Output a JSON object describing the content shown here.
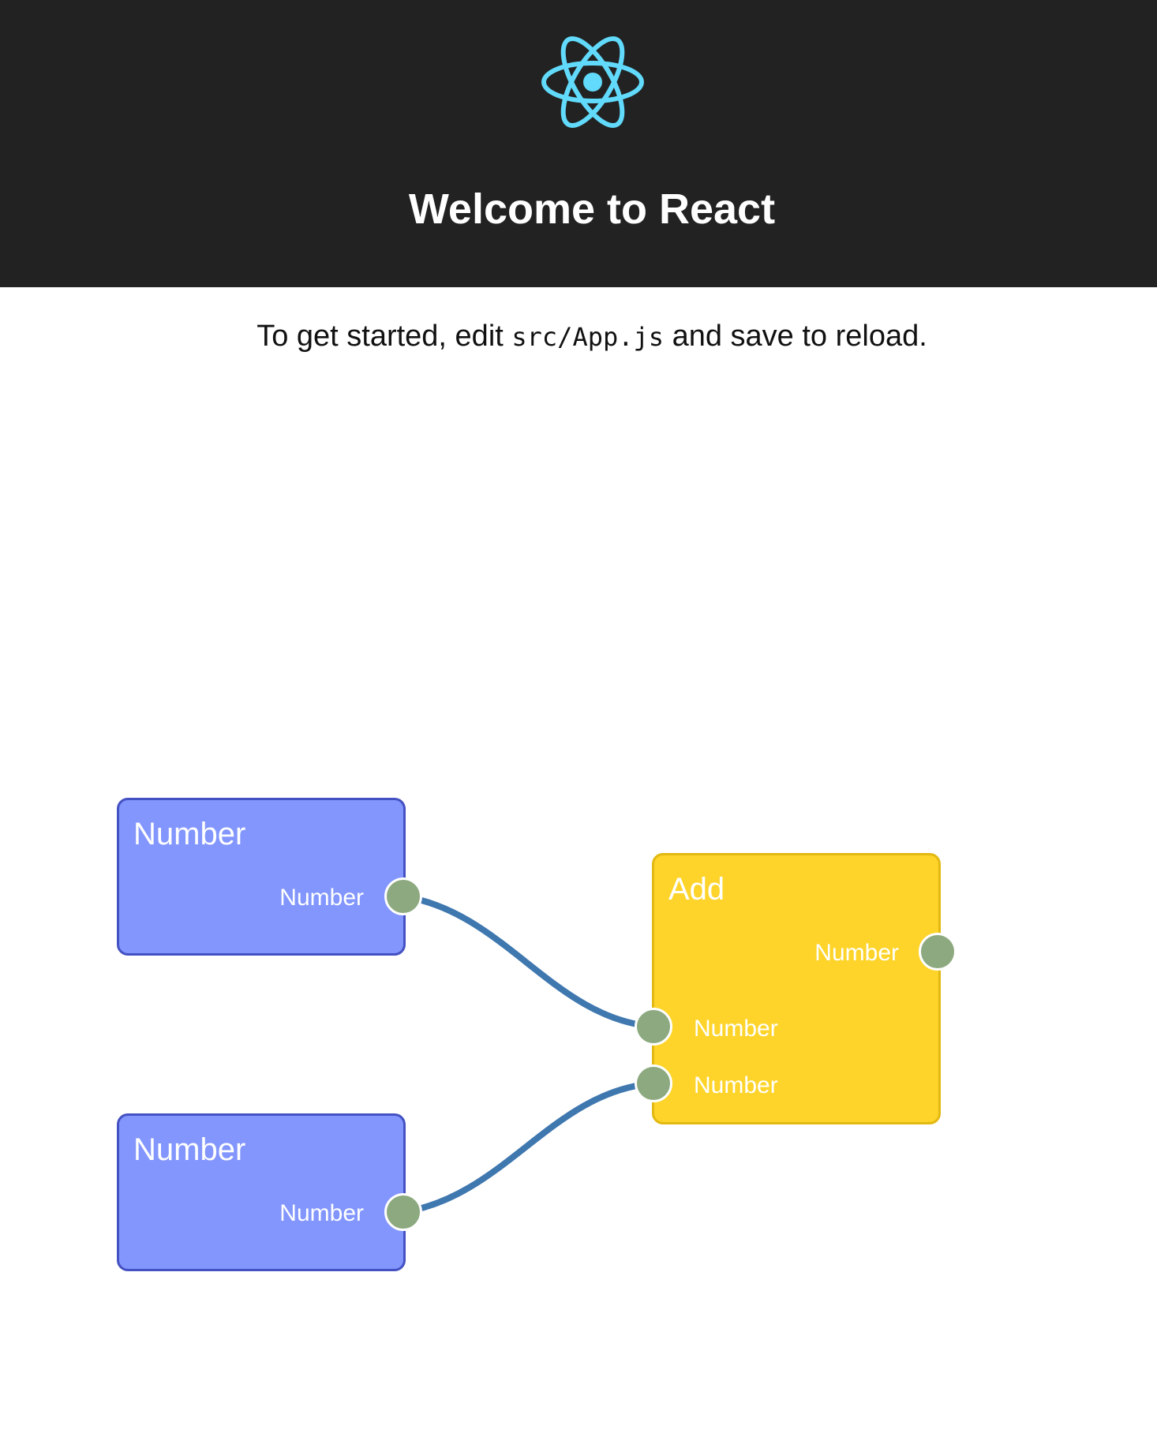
{
  "header": {
    "logo_icon": "react-atom-icon",
    "title": "Welcome to React",
    "background": "#222222",
    "logo_color": "#61dafb"
  },
  "intro": {
    "prefix": "To get started, edit ",
    "code": "src/App.js",
    "suffix": " and save to reload."
  },
  "graph": {
    "colors": {
      "number_node": "#8296fd",
      "add_node": "#fed42a",
      "port": "#8ca97f",
      "link": "#3f77af"
    },
    "nodes": [
      {
        "id": "number-1",
        "type": "Number",
        "title": "Number",
        "outputs": [
          "Number"
        ],
        "inputs": []
      },
      {
        "id": "number-2",
        "type": "Number",
        "title": "Number",
        "outputs": [
          "Number"
        ],
        "inputs": []
      },
      {
        "id": "add-1",
        "type": "Add",
        "title": "Add",
        "outputs": [
          "Number"
        ],
        "inputs": [
          "Number",
          "Number"
        ]
      }
    ],
    "links": [
      {
        "from": "number-1.output.0",
        "to": "add-1.input.0"
      },
      {
        "from": "number-2.output.0",
        "to": "add-1.input.1"
      }
    ]
  }
}
